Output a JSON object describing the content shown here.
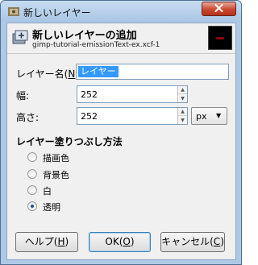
{
  "window": {
    "title": "新しいレイヤー",
    "close_icon": "close-icon"
  },
  "header": {
    "title": "新しいレイヤーの追加",
    "subtitle": "gimp-tutorial-emissionText-ex.xcf-1"
  },
  "form": {
    "name_label_prefix": "レイヤー名(",
    "name_label_key": "N",
    "name_label_suffix": "):",
    "name_value": "レイヤー",
    "width_label": "幅:",
    "width_value": "252",
    "height_label": "高さ:",
    "height_value": "252",
    "unit_value": "px"
  },
  "fill": {
    "title": "レイヤー塗りつぶし方法",
    "options": [
      {
        "label": "描画色",
        "checked": false
      },
      {
        "label": "背景色",
        "checked": false
      },
      {
        "label": "白",
        "checked": false
      },
      {
        "label": "透明",
        "checked": true
      }
    ]
  },
  "buttons": {
    "help_prefix": "ヘルプ(",
    "help_key": "H",
    "help_suffix": ")",
    "ok_prefix": "OK(",
    "ok_key": "O",
    "ok_suffix": ")",
    "cancel_prefix": "キャンセル(",
    "cancel_key": "C",
    "cancel_suffix": ")"
  },
  "colors": {
    "frame": "#aec9e6",
    "selection": "#3399ff",
    "close_button": "#c9472f"
  }
}
